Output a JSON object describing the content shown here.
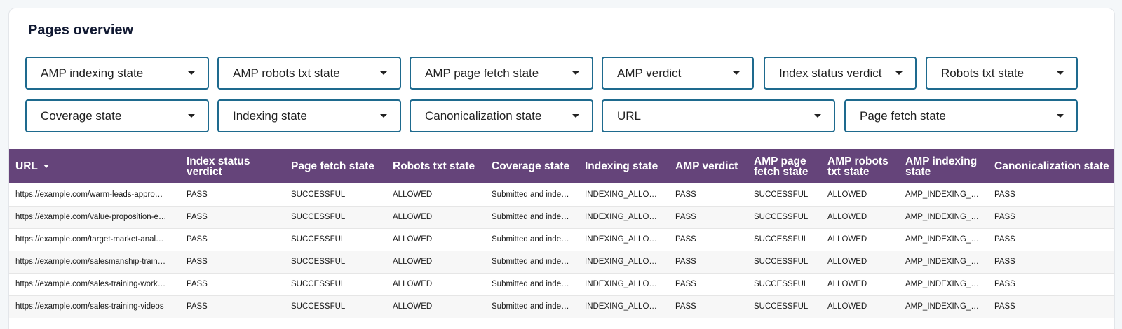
{
  "title": "Pages overview",
  "filters": [
    "AMP indexing state",
    "AMP robots txt state",
    "AMP page fetch state",
    "AMP verdict",
    "Index status verdict",
    "Robots txt state",
    "Coverage state",
    "Indexing state",
    "Canonicalization state",
    "URL",
    "Page fetch state"
  ],
  "colors": {
    "header_bg": "#65447a",
    "filter_border": "#1e6a8e"
  },
  "table": {
    "headers": [
      "URL",
      "Index status verdict",
      "Page fetch state",
      "Robots txt state",
      "Coverage state",
      "Indexing state",
      "AMP verdict",
      "AMP page fetch state",
      "AMP robots txt state",
      "AMP indexing state",
      "Canonicalization state"
    ],
    "sort_column": "URL",
    "sort_direction": "descending",
    "rows": [
      [
        "https://example.com/warm-leads-appro…",
        "PASS",
        "SUCCESSFUL",
        "ALLOWED",
        "Submitted and inde…",
        "INDEXING_ALLOW…",
        "PASS",
        "SUCCESSFUL",
        "ALLOWED",
        "AMP_INDEXING_A…",
        "PASS"
      ],
      [
        "https://example.com/value-proposition-e…",
        "PASS",
        "SUCCESSFUL",
        "ALLOWED",
        "Submitted and inde…",
        "INDEXING_ALLOW…",
        "PASS",
        "SUCCESSFUL",
        "ALLOWED",
        "AMP_INDEXING_A…",
        "PASS"
      ],
      [
        "https://example.com/target-market-anal…",
        "PASS",
        "SUCCESSFUL",
        "ALLOWED",
        "Submitted and inde…",
        "INDEXING_ALLOW…",
        "PASS",
        "SUCCESSFUL",
        "ALLOWED",
        "AMP_INDEXING_A…",
        "PASS"
      ],
      [
        "https://example.com/salesmanship-train…",
        "PASS",
        "SUCCESSFUL",
        "ALLOWED",
        "Submitted and inde…",
        "INDEXING_ALLOW…",
        "PASS",
        "SUCCESSFUL",
        "ALLOWED",
        "AMP_INDEXING_A…",
        "PASS"
      ],
      [
        "https://example.com/sales-training-work…",
        "PASS",
        "SUCCESSFUL",
        "ALLOWED",
        "Submitted and inde…",
        "INDEXING_ALLOW…",
        "PASS",
        "SUCCESSFUL",
        "ALLOWED",
        "AMP_INDEXING_A…",
        "PASS"
      ],
      [
        "https://example.com/sales-training-videos",
        "PASS",
        "SUCCESSFUL",
        "ALLOWED",
        "Submitted and inde…",
        "INDEXING_ALLOW…",
        "PASS",
        "SUCCESSFUL",
        "ALLOWED",
        "AMP_INDEXING_A…",
        "PASS"
      ]
    ]
  }
}
